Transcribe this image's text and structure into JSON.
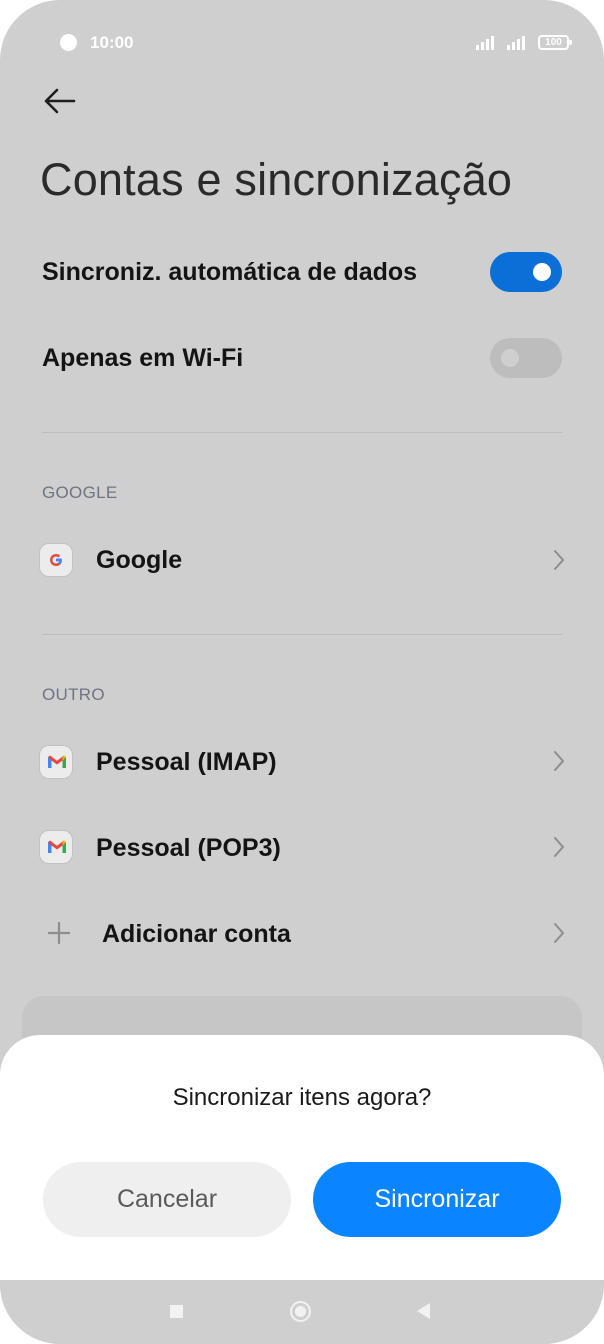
{
  "status_bar": {
    "time": "10:00",
    "battery": "100"
  },
  "page": {
    "title": "Contas e sincronização"
  },
  "settings": [
    {
      "label": "Sincroniz. automática de dados",
      "on": true
    },
    {
      "label": "Apenas em Wi-Fi",
      "on": false
    }
  ],
  "sections": [
    {
      "header": "GOOGLE",
      "accounts": [
        {
          "label": "Google",
          "icon": "google-icon"
        }
      ]
    },
    {
      "header": "OUTRO",
      "accounts": [
        {
          "label": "Pessoal (IMAP)",
          "icon": "gmail-icon"
        },
        {
          "label": "Pessoal (POP3)",
          "icon": "gmail-icon"
        },
        {
          "label": "Adicionar conta",
          "icon": "plus-icon"
        }
      ]
    }
  ],
  "dialog": {
    "title": "Sincronizar itens agora?",
    "cancel_label": "Cancelar",
    "confirm_label": "Sincronizar"
  },
  "colors": {
    "accent": "#0a84ff",
    "toggle_on": "#0a6fd6",
    "toggle_off": "#bdbdbd",
    "scrim_background": "#cfcfcf"
  }
}
